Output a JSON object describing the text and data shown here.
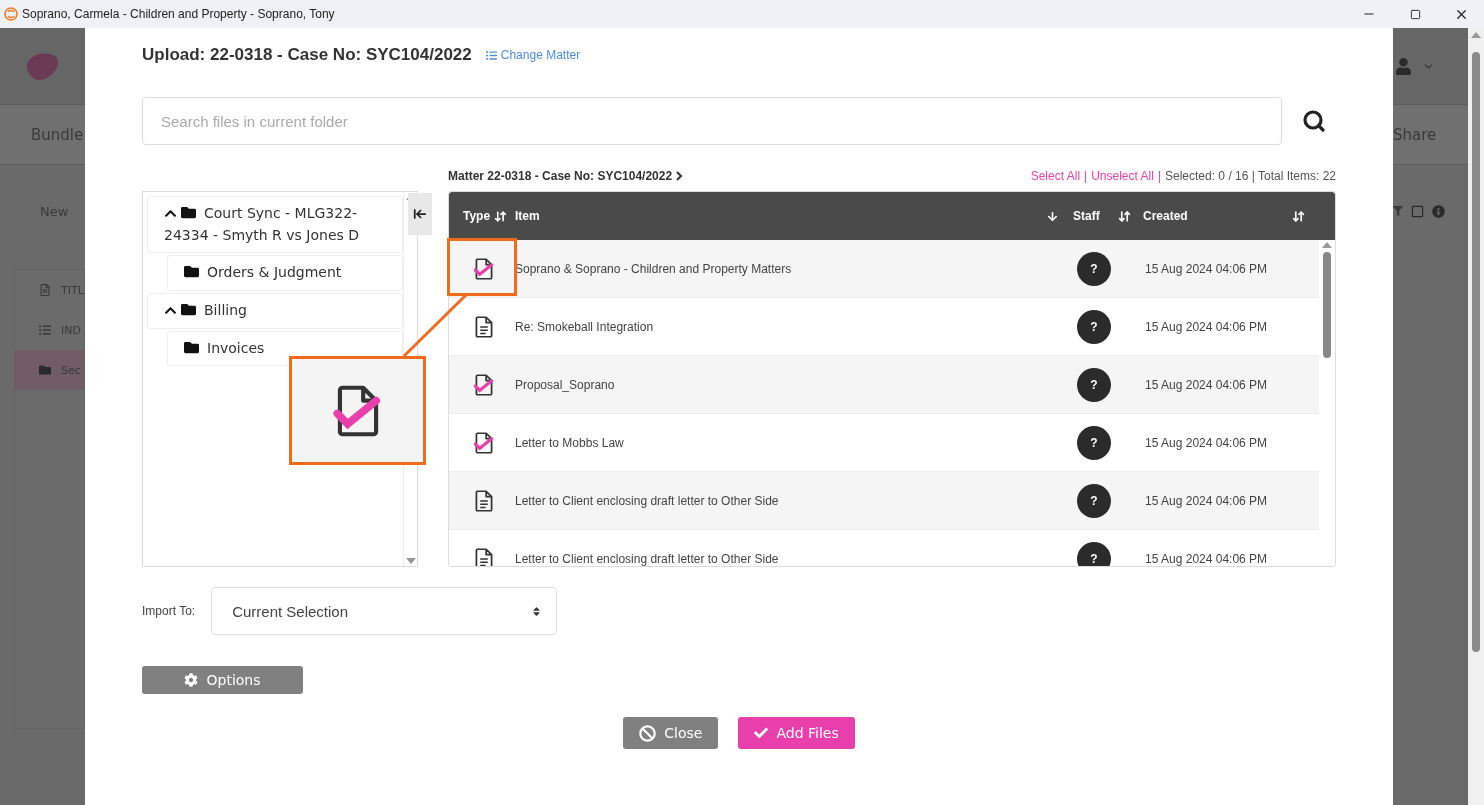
{
  "window": {
    "title": "Soprano, Carmela - Children and Property - Soprano, Tony"
  },
  "background": {
    "left": {
      "tab": "Bundle",
      "new_button": "New",
      "sidebar_items": [
        {
          "label": "TITL",
          "kind": "doc",
          "selected": false
        },
        {
          "label": "IND",
          "kind": "list",
          "selected": false
        },
        {
          "label": "Sec",
          "kind": "folder",
          "selected": true
        }
      ]
    },
    "right": {
      "tab": "Share"
    }
  },
  "modal": {
    "title": "Upload: 22-0318 - Case No: SYC104/2022",
    "change_link": "Change Matter",
    "search": {
      "placeholder": "Search files in current folder"
    },
    "tree": [
      {
        "label": "Court Sync - MLG322-24334 - Smyth R vs Jones D",
        "expanded": true,
        "children": [
          {
            "label": "Orders & Judgment"
          }
        ]
      },
      {
        "label": "Billing",
        "expanded": true,
        "children": [
          {
            "label": "Invoices"
          }
        ]
      }
    ],
    "breadcrumb": "Matter 22-0318 - Case No: SYC104/2022",
    "selection_links": [
      {
        "label": "Select All",
        "separator": "|"
      },
      {
        "label": "Unselect All",
        "separator": "|"
      }
    ],
    "selection_status": "Selected: 0 / 16 | Total Items: 22",
    "table": {
      "columns": [
        {
          "label": "Type",
          "sorted_descending": false
        },
        {
          "label": "Item",
          "sorted_descending": true
        },
        {
          "label": "Staff",
          "sorted_descending": false
        },
        {
          "label": "Created",
          "sorted_descending": false
        }
      ],
      "rows": [
        {
          "item": "Soprano & Soprano - Children and Property Matters",
          "checked": true,
          "staff": "?",
          "created": "15 Aug 2024 04:06 PM"
        },
        {
          "item": "Re: Smokeball Integration",
          "checked": false,
          "staff": "?",
          "created": "15 Aug 2024 04:06 PM"
        },
        {
          "item": "Proposal_Soprano",
          "checked": true,
          "staff": "?",
          "created": "15 Aug 2024 04:06 PM"
        },
        {
          "item": "Letter to Mobbs Law",
          "checked": true,
          "staff": "?",
          "created": "15 Aug 2024 04:06 PM"
        },
        {
          "item": "Letter to Client enclosing draft letter to Other Side",
          "checked": false,
          "staff": "?",
          "created": "15 Aug 2024 04:06 PM"
        },
        {
          "item": "Letter to Client enclosing draft letter to Other Side",
          "checked": false,
          "staff": "?",
          "created": "15 Aug 2024 04:06 PM"
        }
      ]
    },
    "import": {
      "label": "Import To:",
      "value": "Current Selection"
    },
    "options_button": "Options",
    "buttons": [
      {
        "label": "Close",
        "kind": "secondary"
      },
      {
        "label": "Add Files",
        "kind": "primary"
      }
    ]
  }
}
